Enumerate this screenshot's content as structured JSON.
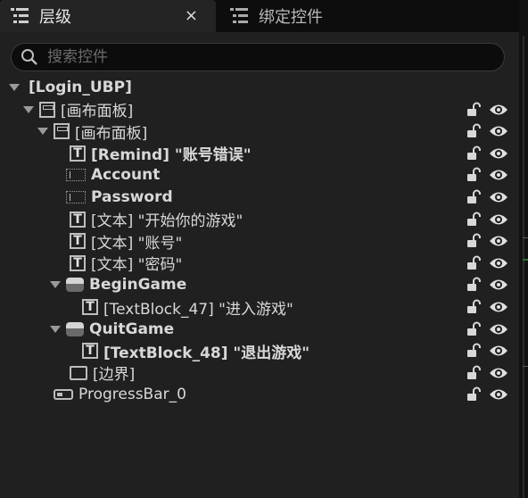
{
  "tabs": {
    "hierarchy_label": "层级",
    "close_label": "×",
    "bind_label": "绑定控件"
  },
  "search": {
    "placeholder": "搜索控件"
  },
  "tree": [
    {
      "label": "[Login_UBP]",
      "bold": true,
      "icon": "none",
      "arrow": true
    },
    {
      "label": "[画布面板]",
      "bold": false,
      "icon": "canvas-panel-icon",
      "arrow": true
    },
    {
      "label": "[画布面板]",
      "bold": false,
      "icon": "canvas-panel-icon",
      "arrow": true
    },
    {
      "label": "[Remind] \"账号错误\"",
      "bold": true,
      "icon": "text-block-icon",
      "arrow": false
    },
    {
      "label": "Account",
      "bold": true,
      "icon": "text-input-icon",
      "arrow": false
    },
    {
      "label": "Password",
      "bold": true,
      "icon": "text-input-icon",
      "arrow": false
    },
    {
      "label": "[文本] \"开始你的游戏\"",
      "bold": false,
      "icon": "text-block-icon",
      "arrow": false
    },
    {
      "label": "[文本] \"账号\"",
      "bold": false,
      "icon": "text-block-icon",
      "arrow": false
    },
    {
      "label": "[文本] \"密码\"",
      "bold": false,
      "icon": "text-block-icon",
      "arrow": false
    },
    {
      "label": "BeginGame",
      "bold": true,
      "icon": "button-icon",
      "arrow": true
    },
    {
      "label": "[TextBlock_47] \"进入游戏\"",
      "bold": false,
      "icon": "text-block-icon",
      "arrow": false
    },
    {
      "label": "QuitGame",
      "bold": true,
      "icon": "button-icon",
      "arrow": true
    },
    {
      "label": "[TextBlock_48] \"退出游戏\"",
      "bold": true,
      "icon": "text-block-icon",
      "arrow": false
    },
    {
      "label": "[边界]",
      "bold": false,
      "icon": "border-icon",
      "arrow": false
    },
    {
      "label": "ProgressBar_0",
      "bold": false,
      "icon": "progress-bar-icon",
      "arrow": false
    }
  ],
  "colors": {
    "panel": "#202020",
    "tabbar": "#0d0d0d",
    "active_tab": "#242424"
  }
}
